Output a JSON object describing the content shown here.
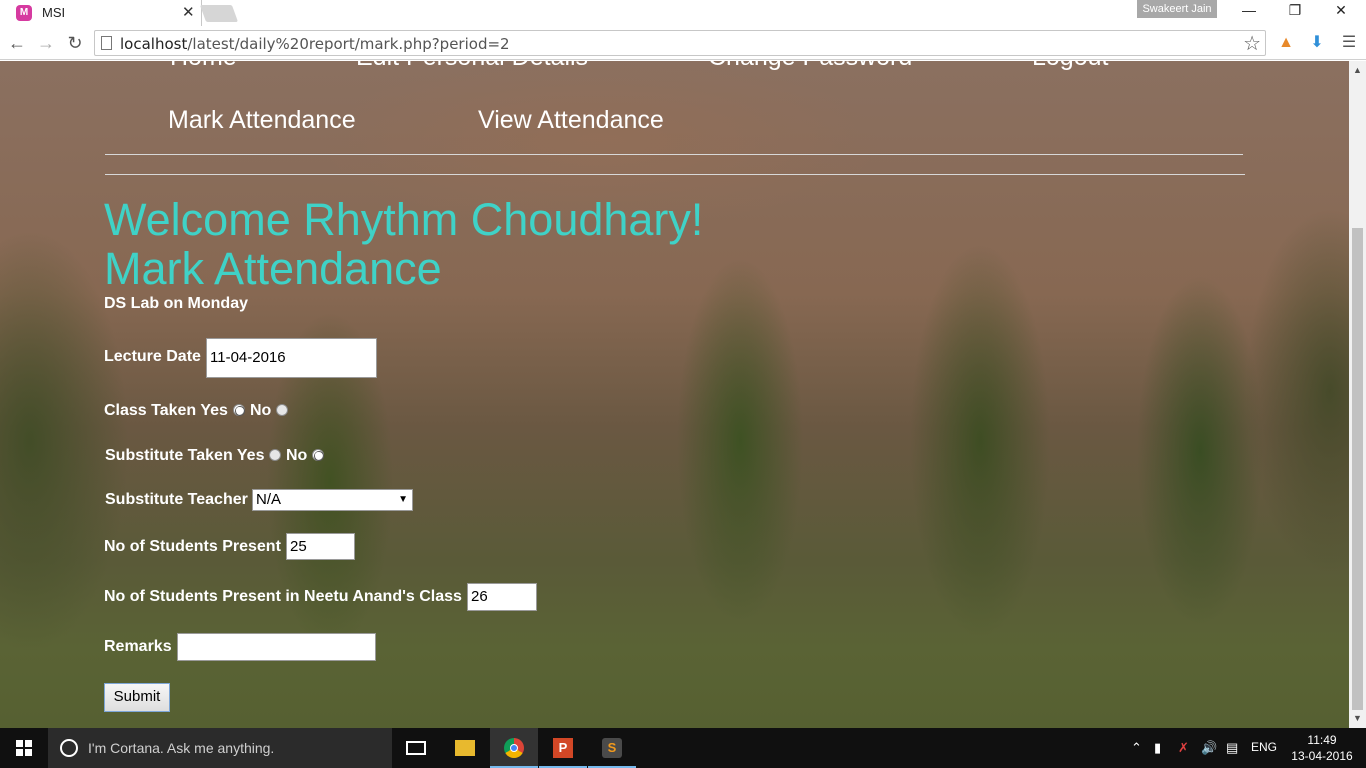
{
  "browser": {
    "tab_title": "MSI",
    "favicon_letter": "M",
    "tab_close": "✕",
    "profile_name": "Swakeert Jain",
    "url_host": "localhost",
    "url_path": "/latest/daily%20report/mark.php?period=2"
  },
  "nav": {
    "clipped": [
      "Home",
      "Edit Personal Details",
      "Change Password",
      "Logout"
    ],
    "links": [
      "Mark Attendance",
      "View Attendance"
    ]
  },
  "page": {
    "welcome": "Welcome Rhythm Choudhary!",
    "heading": "Mark Attendance",
    "subheading": "DS Lab on Monday"
  },
  "form": {
    "lecture_date_label": "Lecture Date",
    "lecture_date_value": "11-04-2016",
    "class_taken_label": "Class Taken",
    "substitute_taken_label": "Substitute Taken",
    "yes_label": "Yes",
    "no_label": "No",
    "class_taken_selected": "yes",
    "substitute_taken_selected": "no",
    "substitute_teacher_label": "Substitute Teacher",
    "substitute_teacher_value": "N/A",
    "students_present_label": "No of Students Present",
    "students_present_value": "25",
    "other_class_label": "No of Students Present in Neetu Anand's Class",
    "other_class_value": "26",
    "remarks_label": "Remarks",
    "remarks_value": "",
    "submit_label": "Submit"
  },
  "taskbar": {
    "cortana_placeholder": "I'm Cortana. Ask me anything.",
    "language": "ENG",
    "time": "11:49",
    "date": "13-04-2016"
  }
}
